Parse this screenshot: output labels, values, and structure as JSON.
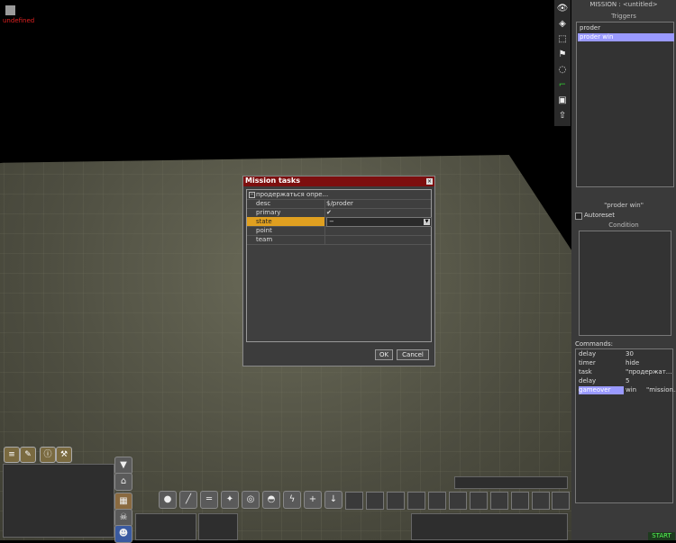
{
  "viewport": {
    "undefined_label": "undefined"
  },
  "dialog": {
    "title": "Mission tasks",
    "close_glyph": "×",
    "group_toggle": "−",
    "group_name": "продержаться опре...",
    "rows": [
      {
        "key": "desc",
        "value": "$/proder"
      },
      {
        "key": "primary",
        "value": "✔"
      },
      {
        "key": "state",
        "value": "−"
      },
      {
        "key": "point",
        "value": ""
      },
      {
        "key": "team",
        "value": ""
      }
    ],
    "ok_label": "OK",
    "cancel_label": "Cancel",
    "dropdown_arrow": "▼"
  },
  "panel": {
    "title": "MISSION : <untitled>",
    "triggers_label": "Triggers",
    "triggers": [
      {
        "name": "proder",
        "selected": false
      },
      {
        "name": "proder win",
        "selected": true
      }
    ],
    "selected_trigger_label": "\"proder win\"",
    "autoreset_label": "Autoreset",
    "condition_label": "Condition",
    "commands_label": "Commands:",
    "commands": [
      {
        "name": "delay",
        "arg1": "30",
        "arg2": "",
        "selected": false
      },
      {
        "name": "timer",
        "arg1": "hide",
        "arg2": "",
        "selected": false
      },
      {
        "name": "task",
        "arg1": "\"продержат...",
        "arg2": "",
        "selected": false
      },
      {
        "name": "delay",
        "arg1": "5",
        "arg2": "",
        "selected": false
      },
      {
        "name": "gameover",
        "arg1": "win",
        "arg2": "\"mission...",
        "selected": true
      }
    ],
    "start_label": "START"
  },
  "toolbar_icons": [
    "eye-icon",
    "tag-icon",
    "selection-icon",
    "flag-icon",
    "circle-icon",
    "step-icon",
    "camera-icon",
    "arrow-up-icon"
  ],
  "colors": {
    "dialog_title_bg": "#7d0f0f",
    "selected_bg": "#9a9aff",
    "highlight_row": "#e0a020",
    "undefined_text": "#e02020",
    "start_text": "#55ff55"
  }
}
